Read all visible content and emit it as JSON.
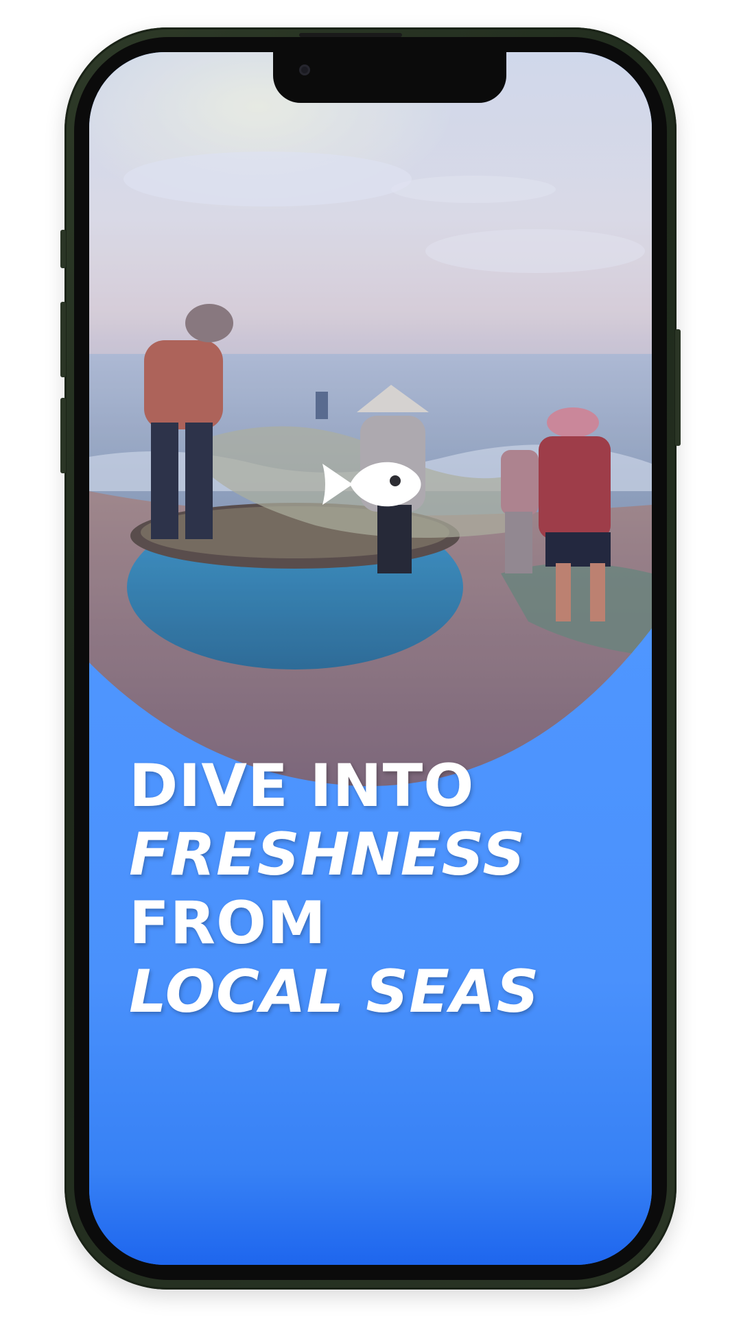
{
  "screen": {
    "brand_icon": "fish-icon",
    "headline": {
      "line1": "DIVE INTO",
      "line2": "FRESHNESS",
      "line3": "FROM",
      "line4": "LOCAL SEAS"
    }
  },
  "colors": {
    "accent_blue": "#2f7cf6",
    "headline_text": "#ffffff",
    "device_frame": "#2a3525"
  },
  "background_image": "fishermen hauling nets beside a round basket boat on the beach"
}
